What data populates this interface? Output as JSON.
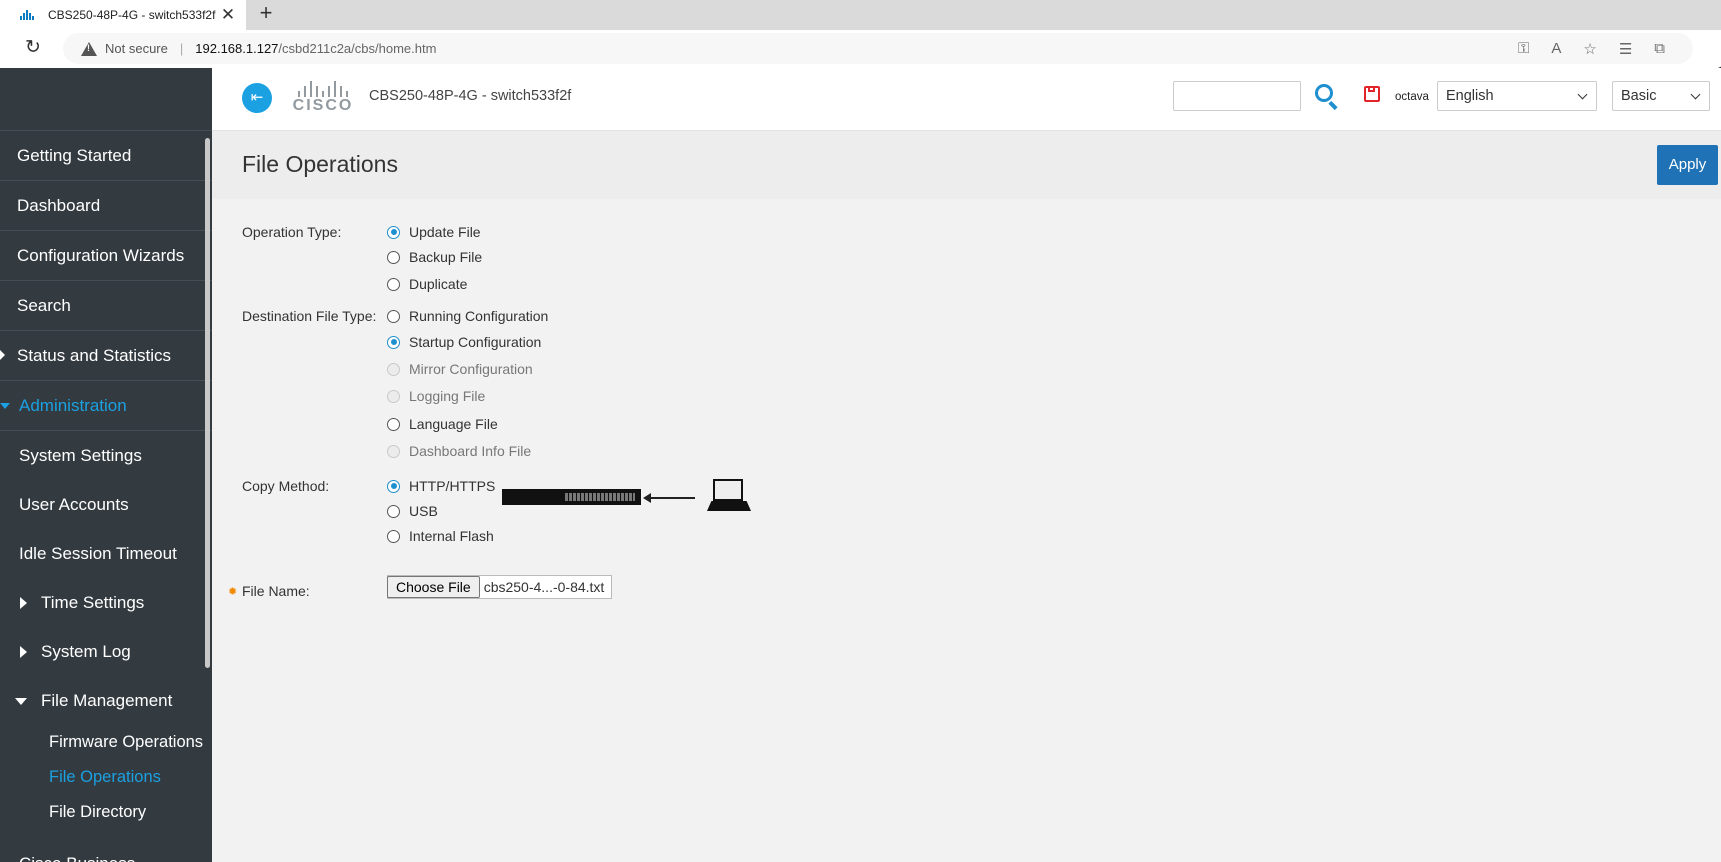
{
  "browser": {
    "tab_title": "CBS250-48P-4G - switch533f2f",
    "not_secure": "Not secure",
    "url_host": "192.168.1.127",
    "url_path": "/csbd211c2a/cbs/home.htm"
  },
  "sidebar": {
    "top_items": [
      "Getting Started",
      "Dashboard",
      "Configuration Wizards",
      "Search",
      "Status and Statistics"
    ],
    "section": "Administration",
    "sub_items": [
      "System Settings",
      "User Accounts",
      "Idle Session Timeout"
    ],
    "time_settings": "Time Settings",
    "system_log": "System Log",
    "file_management": "File Management",
    "file_items": [
      "Firmware Operations",
      "File Operations",
      "File Directory"
    ],
    "bottom_item": "Cisco Business"
  },
  "header": {
    "logo_text": "CISCO",
    "device_title": "CBS250-48P-4G - switch533f2f",
    "search_value": "",
    "username": "octava",
    "language": "English",
    "mode": "Basic"
  },
  "page": {
    "title": "File Operations",
    "apply_label": "Apply"
  },
  "form": {
    "operation_type_label": "Operation Type:",
    "operation_types": [
      {
        "label": "Update File",
        "checked": true
      },
      {
        "label": "Backup File",
        "checked": false
      },
      {
        "label": "Duplicate",
        "checked": false
      }
    ],
    "destination_label": "Destination File Type:",
    "destination_types": [
      {
        "label": "Running Configuration",
        "checked": false,
        "disabled": false
      },
      {
        "label": "Startup Configuration",
        "checked": true,
        "disabled": false
      },
      {
        "label": "Mirror Configuration",
        "checked": false,
        "disabled": true
      },
      {
        "label": "Logging File",
        "checked": false,
        "disabled": true
      },
      {
        "label": "Language File",
        "checked": false,
        "disabled": false
      },
      {
        "label": "Dashboard Info File",
        "checked": false,
        "disabled": true
      }
    ],
    "copy_method_label": "Copy Method:",
    "copy_methods": [
      {
        "label": "HTTP/HTTPS",
        "checked": true
      },
      {
        "label": "USB",
        "checked": false
      },
      {
        "label": "Internal Flash",
        "checked": false
      }
    ],
    "file_name_label": "File Name:",
    "choose_file_label": "Choose File",
    "file_chosen": "cbs250-4...-0-84.txt"
  },
  "colors": {
    "accent": "#1ba0e1",
    "apply": "#1f72b5",
    "sidebar_bg": "#333a40",
    "save_icon": "#e0262b"
  },
  "icons": [
    "reload-icon",
    "warning-icon",
    "collapse-icon",
    "search-icon",
    "save-icon",
    "switch-icon",
    "laptop-icon"
  ]
}
